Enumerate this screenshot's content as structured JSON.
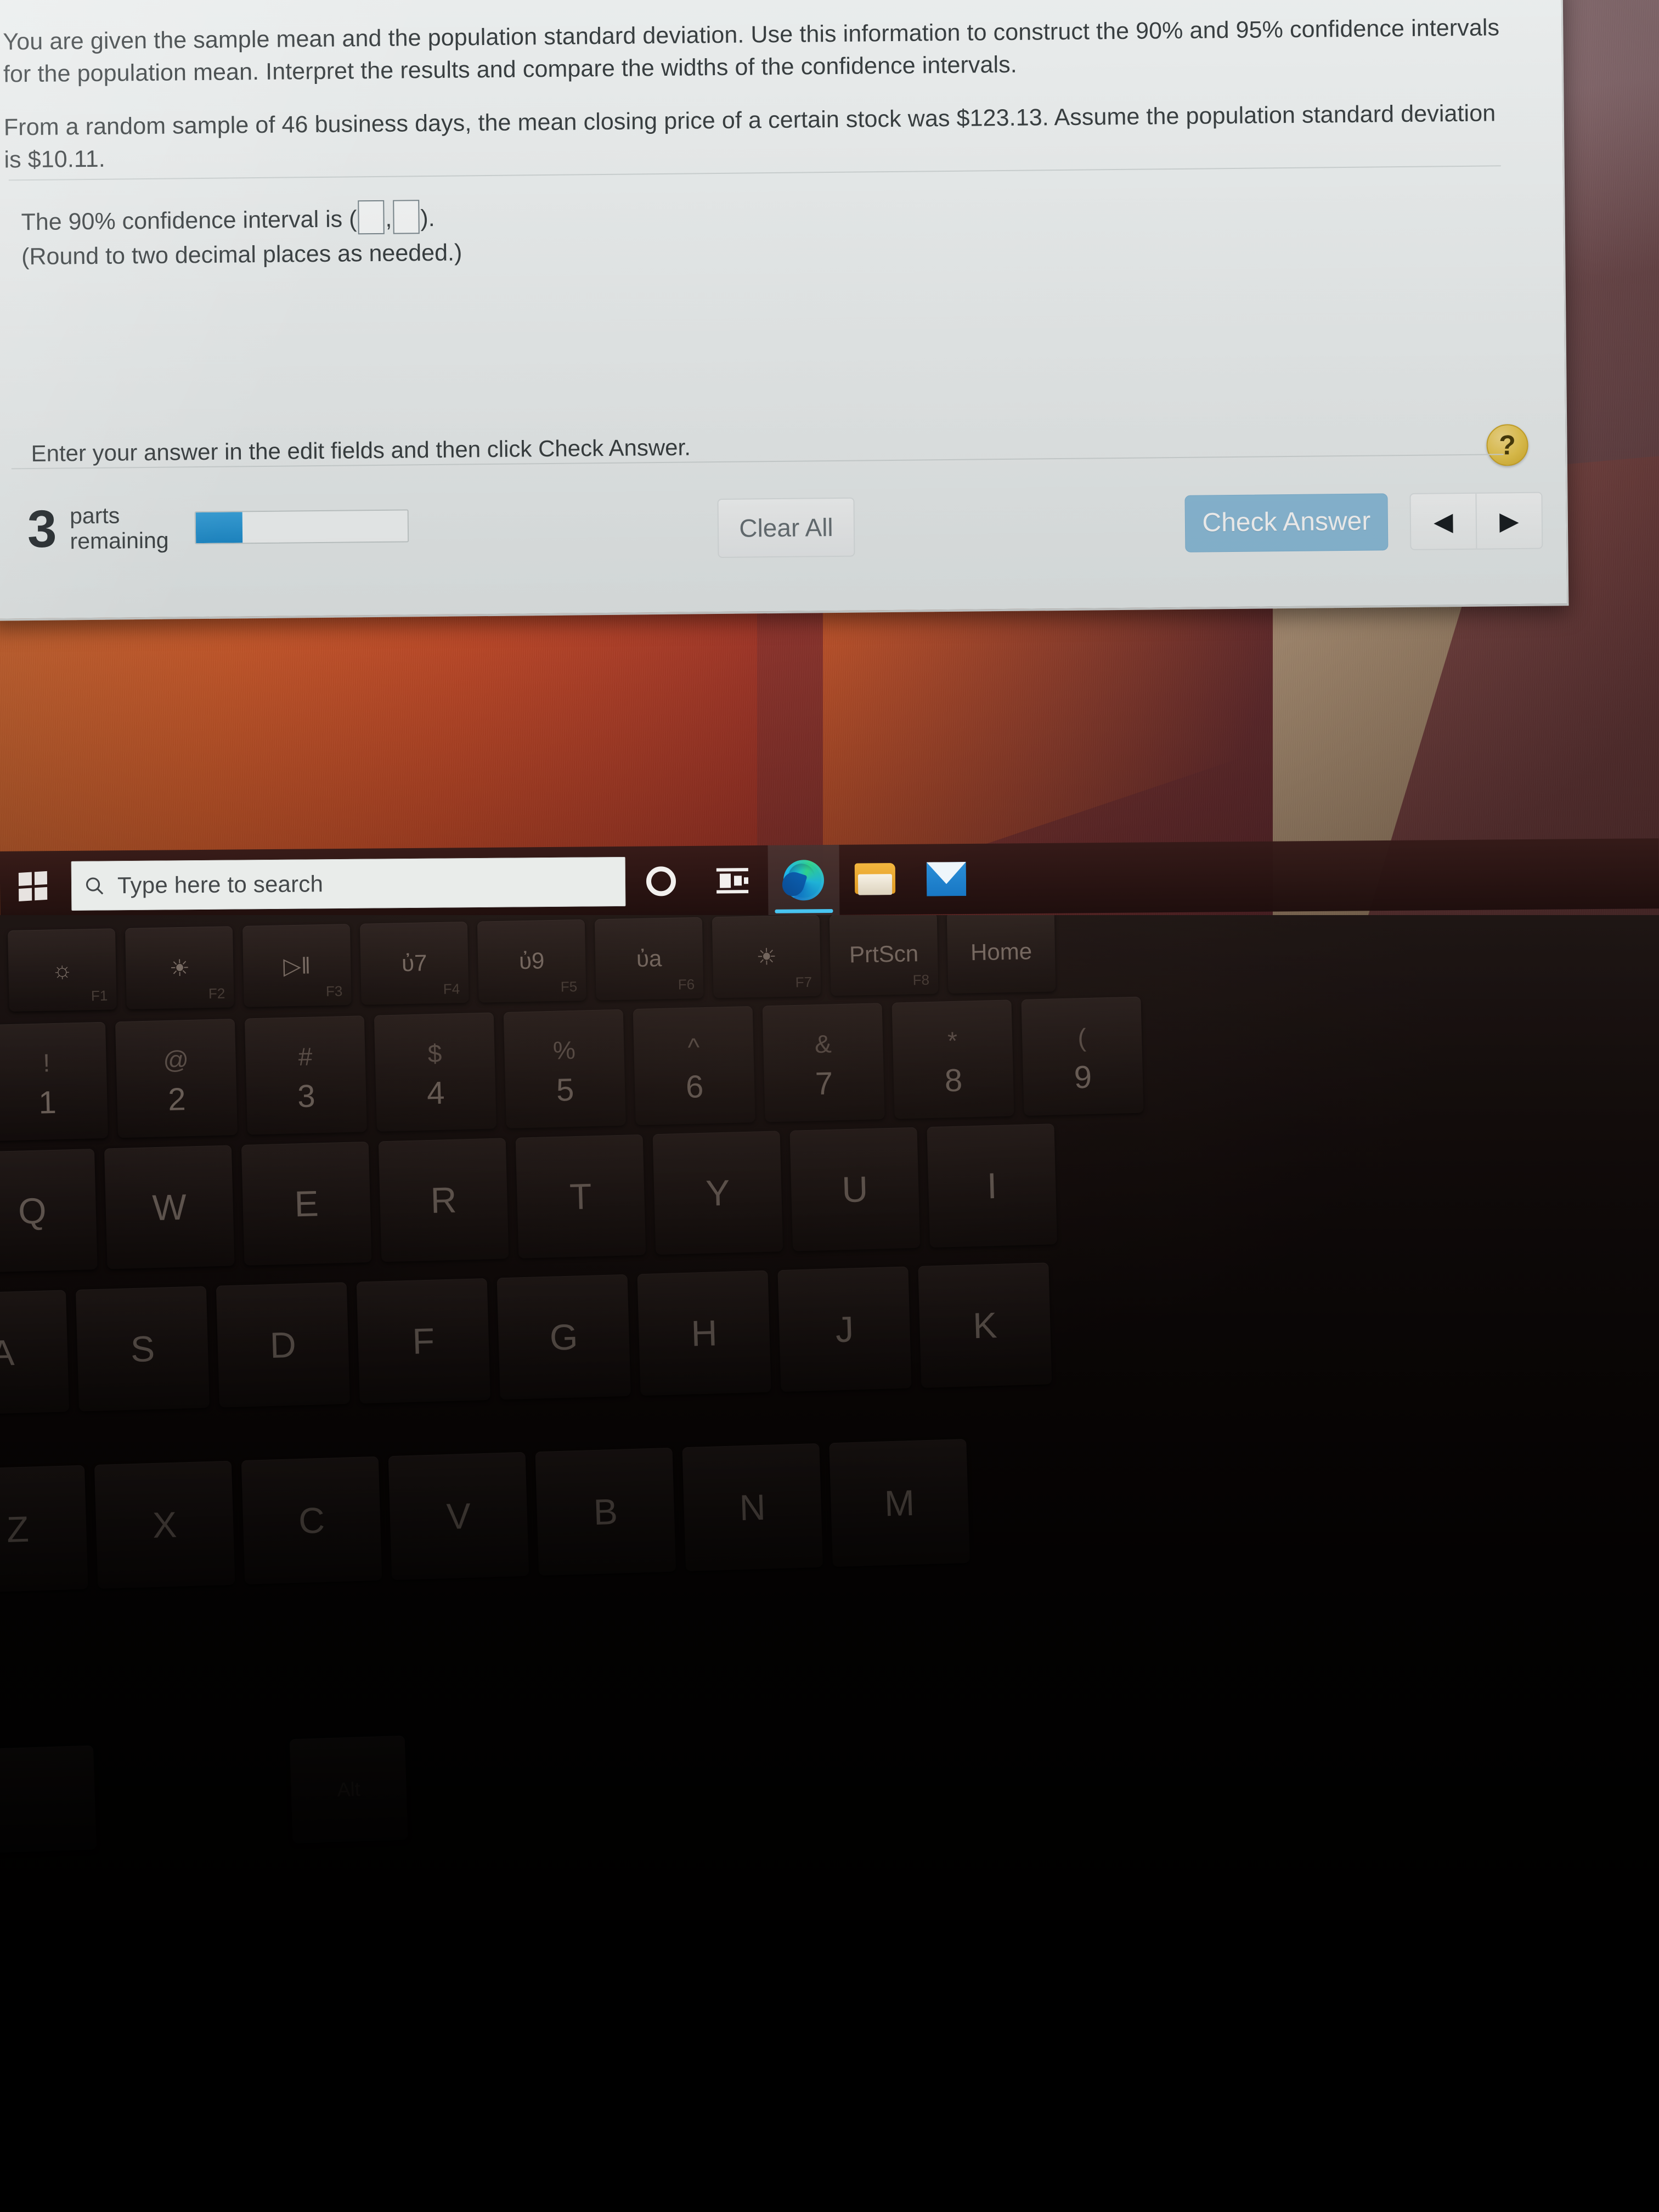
{
  "problem": {
    "stem_line_1": "You are given the sample mean and the population standard deviation. Use this information to construct the 90% and 95% confidence intervals for the population mean. Interpret the results and compare the widths of the confidence intervals.",
    "stem_line_2": "From a random sample of 46 business days, the mean closing price of a certain stock was $123.13. Assume the population standard deviation is $10.11.",
    "answer_prefix": "The 90% confidence interval is (",
    "answer_separator": ",",
    "answer_suffix": ").",
    "rounding_note": "(Round to two decimal places as needed.)",
    "instruction": "Enter your answer in the edit fields and then click Check Answer.",
    "help_badge": "?"
  },
  "toolbar": {
    "parts_count": "3",
    "parts_label_line_1": "parts",
    "parts_label_line_2": "remaining",
    "progress_percent": "22",
    "clear_all_label": "Clear All",
    "check_answer_label": "Check Answer",
    "prev_arrow": "◀",
    "next_arrow": "▶"
  },
  "colors": {
    "check_answer_bg": "#8fc0dd",
    "progress_fill": "#1f8fd0",
    "help_badge_bg": "#e9c84f",
    "taskbar_bg": "#2b1513",
    "edge_accent": "#48c4f0"
  },
  "taskbar": {
    "start_icon": "windows-logo-icon",
    "search_placeholder": "Type here to search",
    "search_icon": "search-icon",
    "items": [
      {
        "name": "cortana-icon",
        "label": "Cortana"
      },
      {
        "name": "task-view-icon",
        "label": "Task View"
      },
      {
        "name": "edge-icon",
        "label": "Microsoft Edge",
        "active": true
      },
      {
        "name": "file-explorer-icon",
        "label": "File Explorer"
      },
      {
        "name": "mail-icon",
        "label": "Mail"
      }
    ]
  },
  "keyboard": {
    "function_row": [
      {
        "glyph": "☼",
        "sub": "F1"
      },
      {
        "glyph": "☀",
        "sub": "F2"
      },
      {
        "glyph": "▷‖",
        "sub": "F3"
      },
      {
        "glyph": "ὐ7",
        "sub": "F4"
      },
      {
        "glyph": "ὐ9",
        "sub": "F5"
      },
      {
        "glyph": "ὐa",
        "sub": "F6"
      },
      {
        "glyph": "☀",
        "sub": "F7"
      },
      {
        "glyph": "PrtScn",
        "sub": "F8"
      },
      {
        "glyph": "Home",
        "sub": ""
      }
    ],
    "number_row": [
      {
        "shift": "!",
        "primary": "1"
      },
      {
        "shift": "@",
        "primary": "2"
      },
      {
        "shift": "#",
        "primary": "3"
      },
      {
        "shift": "$",
        "primary": "4"
      },
      {
        "shift": "%",
        "primary": "5"
      },
      {
        "shift": "^",
        "primary": "6"
      },
      {
        "shift": "&",
        "primary": "7"
      },
      {
        "shift": "*",
        "primary": "8"
      },
      {
        "shift": "(",
        "primary": "9"
      }
    ],
    "qwerty_row": [
      "Q",
      "W",
      "E",
      "R",
      "T",
      "Y",
      "U",
      "I"
    ],
    "home_row": [
      "A",
      "S",
      "D",
      "F",
      "G",
      "H",
      "J",
      "K"
    ],
    "bottom_row": [
      "Z",
      "X",
      "C",
      "V",
      "B",
      "N",
      "M"
    ],
    "modifier_row": [
      "",
      "Alt"
    ]
  }
}
